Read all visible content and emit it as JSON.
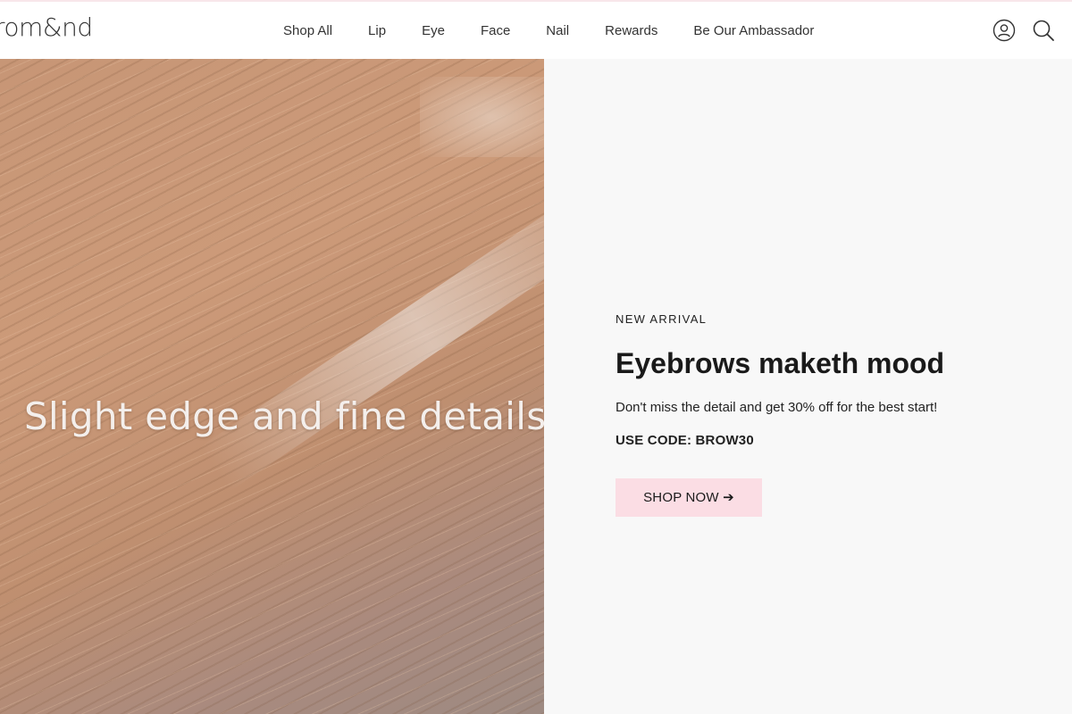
{
  "brand": {
    "logo_text": "rom&nd"
  },
  "nav": {
    "items": [
      {
        "label": "Shop All"
      },
      {
        "label": "Lip"
      },
      {
        "label": "Eye"
      },
      {
        "label": "Face"
      },
      {
        "label": "Nail"
      },
      {
        "label": "Rewards"
      },
      {
        "label": "Be Our Ambassador"
      }
    ]
  },
  "header_icons": {
    "account": "account-icon",
    "search": "search-icon"
  },
  "hero": {
    "image_caption": "Slight edge and fine details",
    "eyebrow": "NEW ARRIVAL",
    "title": "Eyebrows maketh mood",
    "description": "Don't miss the detail and get 30% off for the best start!",
    "code_text": "USE CODE: BROW30",
    "cta_label": "SHOP NOW ➔"
  },
  "colors": {
    "accent_pink": "#fbdde4",
    "panel_bg": "#f8f8f8",
    "text": "#222222"
  }
}
